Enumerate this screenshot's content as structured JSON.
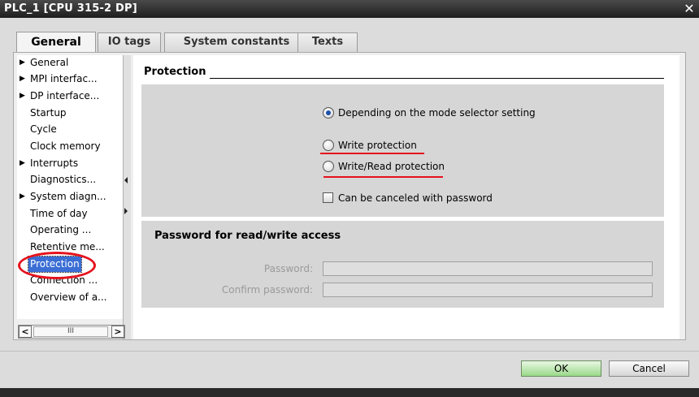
{
  "window": {
    "title": "PLC_1 [CPU 315-2 DP]",
    "close_glyph": "✕"
  },
  "tabs": [
    {
      "label": "General",
      "active": true
    },
    {
      "label": "IO tags",
      "active": false
    },
    {
      "label": "System constants",
      "active": false
    },
    {
      "label": "Texts",
      "active": false
    }
  ],
  "nav": {
    "items": [
      {
        "label": "General",
        "expandable": true
      },
      {
        "label": "MPI interfac...",
        "expandable": true
      },
      {
        "label": "DP interface...",
        "expandable": true
      },
      {
        "label": "Startup",
        "expandable": false
      },
      {
        "label": "Cycle",
        "expandable": false
      },
      {
        "label": "Clock memory",
        "expandable": false
      },
      {
        "label": "Interrupts",
        "expandable": true
      },
      {
        "label": "Diagnostics...",
        "expandable": false
      },
      {
        "label": "System diagn...",
        "expandable": true
      },
      {
        "label": "Time of day",
        "expandable": false
      },
      {
        "label": "Operating ...",
        "expandable": false
      },
      {
        "label": "Retentive me...",
        "expandable": false
      },
      {
        "label": "Protection",
        "expandable": false,
        "selected": true
      },
      {
        "label": "Connection ...",
        "expandable": false
      },
      {
        "label": "Overview of a...",
        "expandable": false
      }
    ],
    "scroll_left": "<",
    "scroll_right": ">",
    "scroll_thumb": "III"
  },
  "protection": {
    "section_title": "Protection",
    "options": [
      {
        "label": "Depending on the mode selector setting",
        "selected": true
      },
      {
        "label": "Write protection",
        "selected": false
      },
      {
        "label": "Write/Read protection",
        "selected": false
      }
    ],
    "cancel_with_password": {
      "label": "Can be canceled with password",
      "checked": false
    }
  },
  "password": {
    "title": "Password for read/write access",
    "password_label": "Password:",
    "password_value": "",
    "confirm_label": "Confirm password:",
    "confirm_value": ""
  },
  "buttons": {
    "ok": "OK",
    "cancel": "Cancel"
  },
  "colors": {
    "annotation": "#e5121e",
    "selection": "#3b6ed5",
    "ok_green": "#9ad98a"
  }
}
